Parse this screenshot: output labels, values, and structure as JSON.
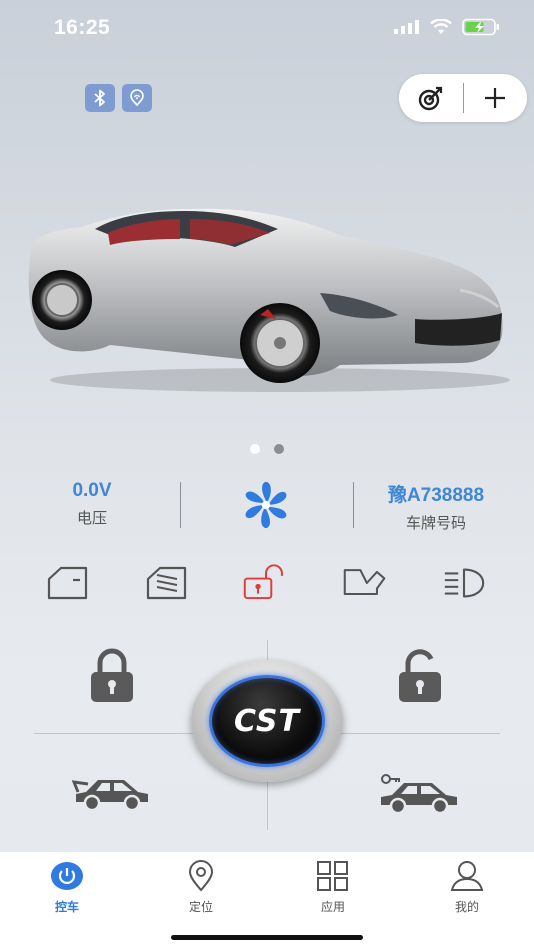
{
  "status_bar": {
    "time": "16:25"
  },
  "badges": [
    {
      "icon": "bluetooth-icon"
    },
    {
      "icon": "location-signal-icon"
    }
  ],
  "top_actions": [
    {
      "icon": "target-icon"
    },
    {
      "icon": "plus-icon"
    }
  ],
  "carousel": {
    "pages": 2,
    "current": 1
  },
  "info": {
    "voltage_value": "0.0V",
    "voltage_label": "电压",
    "plate_value": "豫A738888",
    "plate_label": "车牌号码"
  },
  "status_icons": [
    "door-icon",
    "window-icon",
    "unlock-status-icon",
    "trunk-icon",
    "headlight-icon"
  ],
  "controls": {
    "lock": {
      "icon": "lock-icon"
    },
    "unlock": {
      "icon": "unlock-icon"
    },
    "center_label": "CST",
    "trunk": {
      "icon": "car-trunk-icon"
    },
    "find_car": {
      "icon": "car-key-icon"
    }
  },
  "colors": {
    "accent": "#2f7be0",
    "value_blue": "#3f86d6",
    "alert_red": "#e03a3a",
    "fan_blue": "#2f7be0"
  },
  "tabs": [
    {
      "label": "控车",
      "icon": "power-icon",
      "active": true
    },
    {
      "label": "定位",
      "icon": "map-pin-icon",
      "active": false
    },
    {
      "label": "应用",
      "icon": "grid-icon",
      "active": false
    },
    {
      "label": "我的",
      "icon": "user-icon",
      "active": false
    }
  ]
}
